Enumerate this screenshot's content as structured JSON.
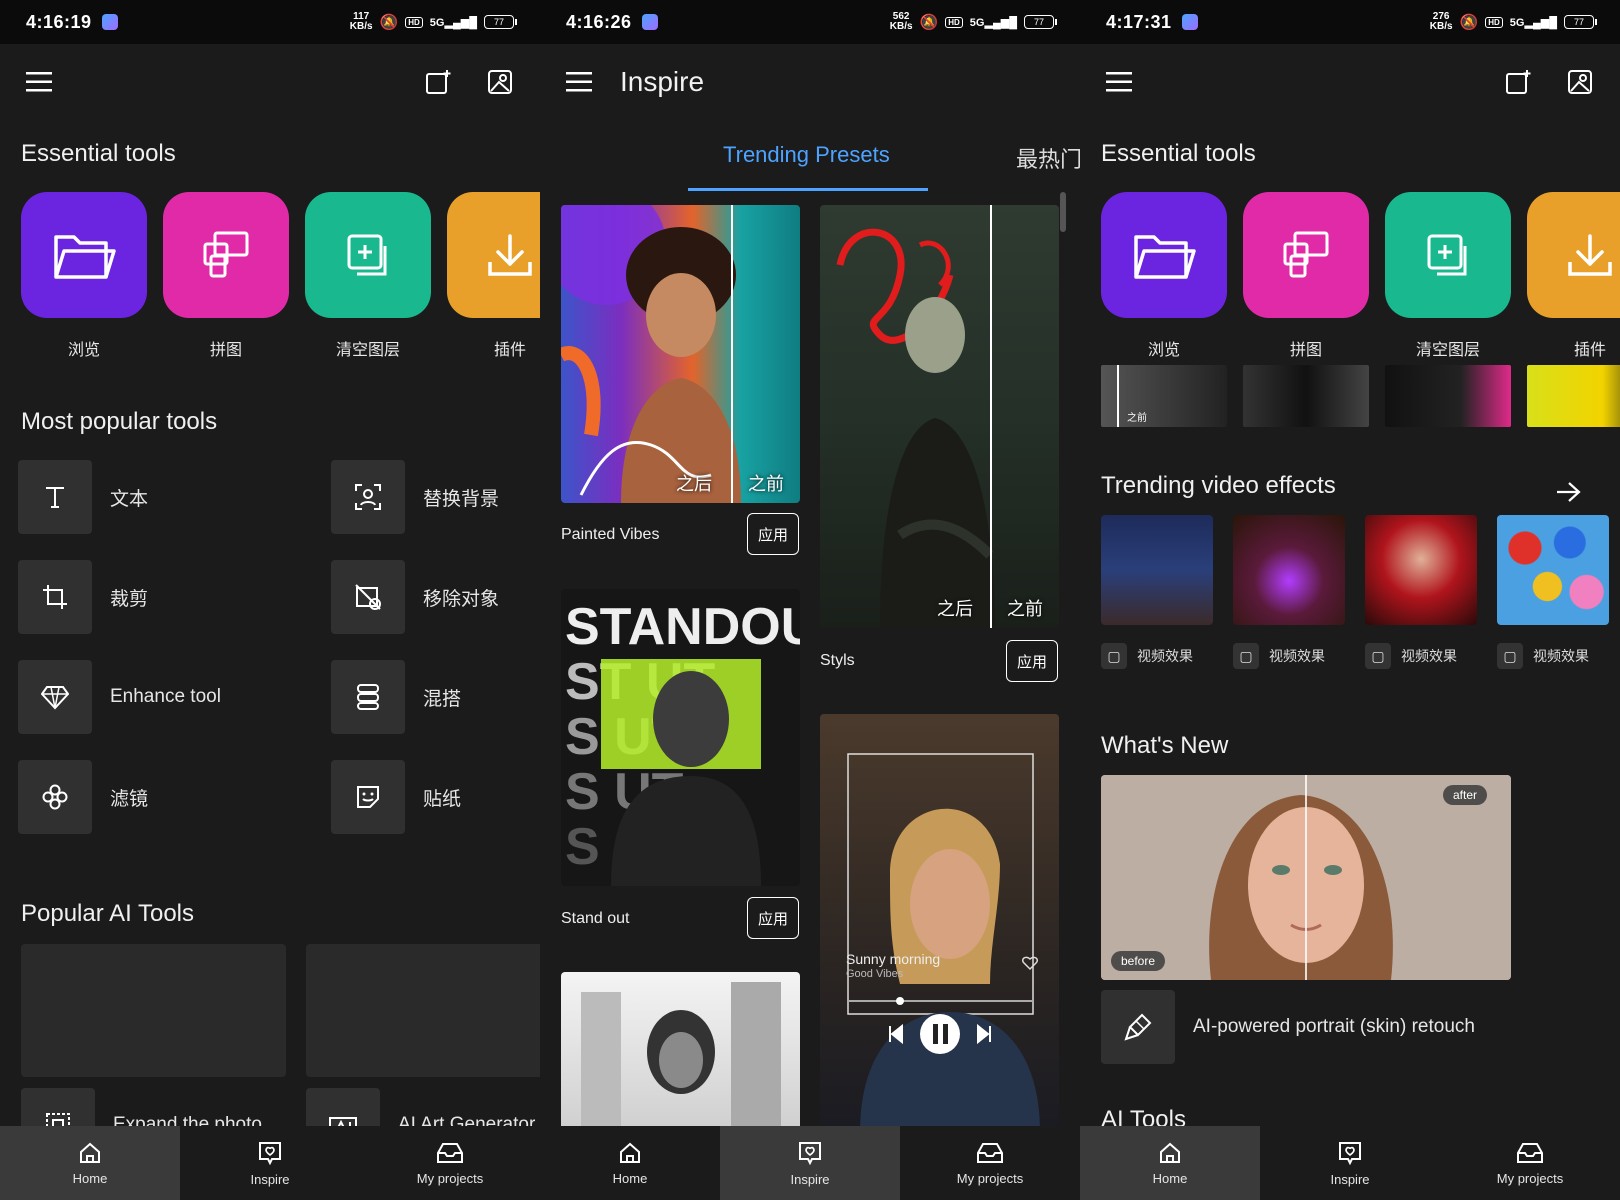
{
  "screens": [
    {
      "status": {
        "time": "4:16:19",
        "speed": "117",
        "speed_unit": "KB/s",
        "hd": "HD",
        "network": "5G",
        "battery": "77"
      },
      "section_essential": "Essential tools",
      "tools": [
        {
          "label": "浏览",
          "color": "#6b24e0",
          "icon": "folder-icon"
        },
        {
          "label": "拼图",
          "color": "#e12aa8",
          "icon": "collage-icon"
        },
        {
          "label": "清空图层",
          "color": "#19b88f",
          "icon": "layer-add-icon"
        },
        {
          "label": "插件",
          "color": "#e8a02a",
          "icon": "download-icon"
        }
      ],
      "section_popular": "Most popular tools",
      "popular": [
        "文本",
        "替换背景",
        "裁剪",
        "移除对象",
        "Enhance tool",
        "混搭",
        "滤镜",
        "贴纸"
      ],
      "section_ai": "Popular AI Tools",
      "ai_tools": [
        "Expand the photo",
        "AI Art Generator"
      ],
      "nav": [
        "Home",
        "Inspire",
        "My projects"
      ]
    },
    {
      "status": {
        "time": "4:16:26",
        "speed": "562",
        "speed_unit": "KB/s",
        "hd": "HD",
        "network": "5G",
        "battery": "77"
      },
      "title": "Inspire",
      "tabs": [
        "Trending Presets",
        "最热门"
      ],
      "presets": [
        {
          "name": "Painted Vibes",
          "apply": "应用",
          "after": "之后",
          "before": "之前"
        },
        {
          "name": "Styls",
          "apply": "应用",
          "after": "之后",
          "before": "之前"
        },
        {
          "name": "Stand out",
          "apply": "应用"
        }
      ],
      "music_card": {
        "song": "Sunny morning",
        "sub": "Good Vibes"
      },
      "nav": [
        "Home",
        "Inspire",
        "My projects"
      ]
    },
    {
      "status": {
        "time": "4:17:31",
        "speed": "276",
        "speed_unit": "KB/s",
        "hd": "HD",
        "network": "5G",
        "battery": "77"
      },
      "section_essential": "Essential tools",
      "tools": [
        {
          "label": "浏览",
          "color": "#6b24e0",
          "icon": "folder-icon"
        },
        {
          "label": "拼图",
          "color": "#e12aa8",
          "icon": "collage-icon"
        },
        {
          "label": "清空图层",
          "color": "#19b88f",
          "icon": "layer-add-icon"
        },
        {
          "label": "插件",
          "color": "#e8a02a",
          "icon": "download-icon"
        }
      ],
      "thumb_label": "之前",
      "section_trending": "Trending video effects",
      "video_effects": [
        "视频效果",
        "视频效果",
        "视频效果",
        "视频效果"
      ],
      "section_new": "What's New",
      "new_after": "after",
      "new_before": "before",
      "new_feature": "AI-powered portrait (skin) retouch",
      "section_ai": "AI Tools",
      "nav": [
        "Home",
        "Inspire",
        "My projects"
      ]
    }
  ]
}
